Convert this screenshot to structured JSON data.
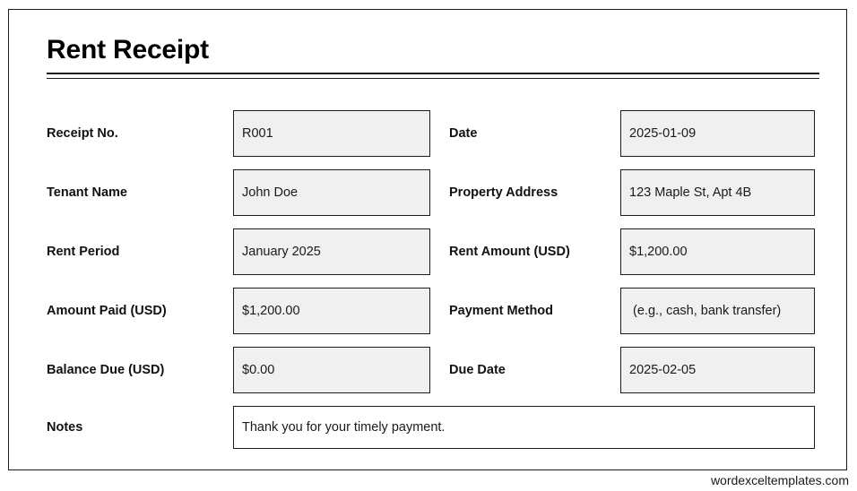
{
  "document": {
    "title": "Rent Receipt"
  },
  "rows": [
    {
      "left": {
        "label": "Receipt No.",
        "value": "R001"
      },
      "right": {
        "label": "Date",
        "value": "2025-01-09"
      }
    },
    {
      "left": {
        "label": "Tenant Name",
        "value": "John Doe"
      },
      "right": {
        "label": "Property Address",
        "value": "123 Maple St, Apt 4B"
      }
    },
    {
      "left": {
        "label": "Rent Period",
        "value": "January 2025"
      },
      "right": {
        "label": "Rent Amount (USD)",
        "value": "$1,200.00"
      }
    },
    {
      "left": {
        "label": "Amount Paid (USD)",
        "value": "$1,200.00"
      },
      "right": {
        "label": "Payment Method",
        "value": " (e.g., cash, bank transfer)"
      }
    },
    {
      "left": {
        "label": "Balance Due (USD)",
        "value": "$0.00"
      },
      "right": {
        "label": "Due Date",
        "value": "2025-02-05"
      }
    }
  ],
  "notes": {
    "label": "Notes",
    "value": "Thank you for your timely payment."
  },
  "footer": {
    "credit": "wordexceltemplates.com"
  },
  "colors": {
    "border": "#1b1b1b",
    "field_fill": "#f0f0f0",
    "notes_fill": "#ffffff",
    "text": "#111111"
  }
}
